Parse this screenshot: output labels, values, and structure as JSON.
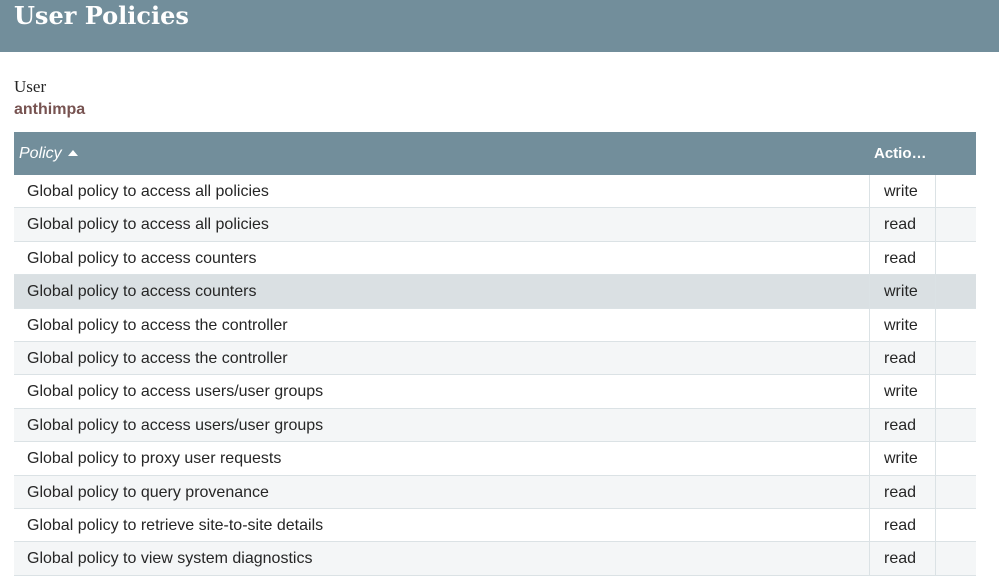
{
  "header": {
    "title": "User Policies"
  },
  "user": {
    "label": "User",
    "value": "anthimpa"
  },
  "table": {
    "columns": {
      "policy": "Policy",
      "action": "Actio…"
    },
    "sort": {
      "column": "Policy",
      "direction": "ascending"
    },
    "rows": [
      {
        "policy": "Global policy to access all policies",
        "action": "write"
      },
      {
        "policy": "Global policy to access all policies",
        "action": "read"
      },
      {
        "policy": "Global policy to access counters",
        "action": "read"
      },
      {
        "policy": "Global policy to access counters",
        "action": "write"
      },
      {
        "policy": "Global policy to access the controller",
        "action": "write"
      },
      {
        "policy": "Global policy to access the controller",
        "action": "read"
      },
      {
        "policy": "Global policy to access users/user groups",
        "action": "write"
      },
      {
        "policy": "Global policy to access users/user groups",
        "action": "read"
      },
      {
        "policy": "Global policy to proxy user requests",
        "action": "write"
      },
      {
        "policy": "Global policy to query provenance",
        "action": "read"
      },
      {
        "policy": "Global policy to retrieve site-to-site details",
        "action": "read"
      },
      {
        "policy": "Global policy to view system diagnostics",
        "action": "read"
      }
    ]
  },
  "colors": {
    "header_bg": "#728e9b",
    "user_value": "#775351",
    "row_alt": "#f4f6f7",
    "row_selected": "#dae0e3",
    "grid_border": "#dbe2e5"
  }
}
